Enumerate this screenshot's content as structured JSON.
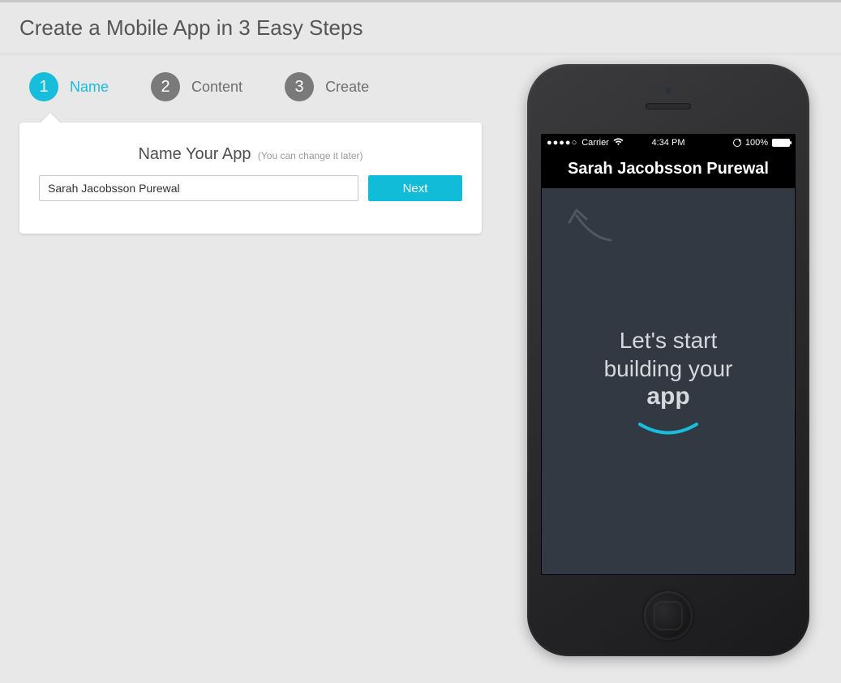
{
  "page_title": "Create a Mobile App in 3 Easy Steps",
  "steps": [
    {
      "num": "1",
      "label": "Name",
      "active": true
    },
    {
      "num": "2",
      "label": "Content",
      "active": false
    },
    {
      "num": "3",
      "label": "Create",
      "active": false
    }
  ],
  "panel": {
    "heading": "Name Your App",
    "subheading": "(You can change it later)",
    "input_value": "Sarah Jacobsson Purewal",
    "next_label": "Next"
  },
  "phone": {
    "status": {
      "signal_dots": "●●●●○",
      "carrier": "Carrier",
      "time": "4:34 PM",
      "battery_pct": "100%"
    },
    "app_title": "Sarah Jacobsson Purewal",
    "prompt_line1": "Let's start",
    "prompt_line2": "building your",
    "prompt_bold": "app"
  },
  "colors": {
    "accent": "#17bedb",
    "step_inactive": "#7a7a7a"
  }
}
